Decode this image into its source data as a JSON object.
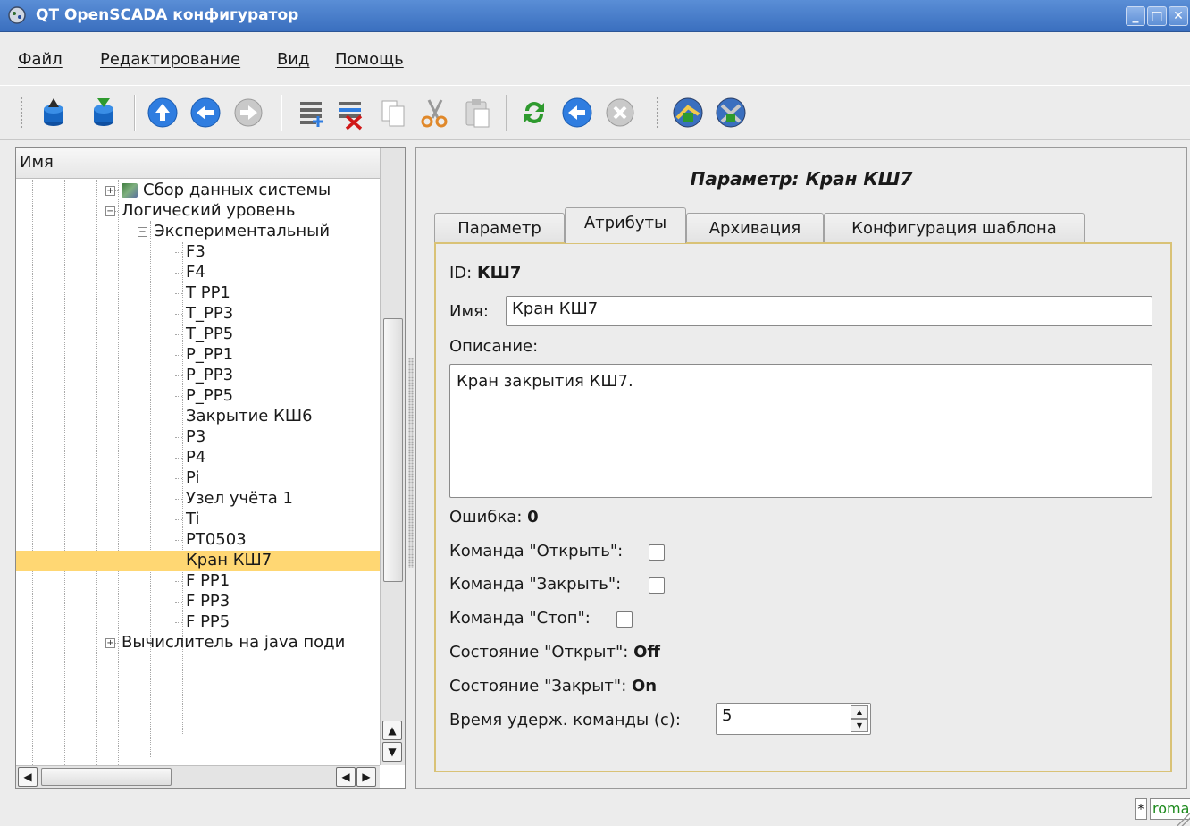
{
  "window": {
    "title": "QT OpenSCADA конфигуратор",
    "minimize": "_",
    "maximize": "□",
    "close": "✕"
  },
  "menu": [
    "Файл",
    "Редактирование",
    "Вид",
    "Помощь"
  ],
  "toolbar": {
    "icons": [
      "db-load-icon",
      "db-save-icon",
      "up-icon",
      "back-icon",
      "forward-icon",
      "add-item-icon",
      "delete-item-icon",
      "copy-icon",
      "cut-icon",
      "paste-icon",
      "refresh-icon",
      "start-icon",
      "stop-icon",
      "station-connect-icon",
      "station-settings-icon"
    ]
  },
  "tree": {
    "header": "Имя",
    "rows": [
      {
        "label": "Сбор данных системы",
        "level": 1,
        "expand": "+",
        "icon": true
      },
      {
        "label": "Логический уровень",
        "level": 1,
        "expand": "−"
      },
      {
        "label": "Экспериментальный",
        "level": 2,
        "expand": "−"
      },
      {
        "label": "F3",
        "level": 3
      },
      {
        "label": "F4",
        "level": 3
      },
      {
        "label": "T PP1",
        "level": 3
      },
      {
        "label": "T_PP3",
        "level": 3
      },
      {
        "label": "T_PP5",
        "level": 3
      },
      {
        "label": "P_PP1",
        "level": 3
      },
      {
        "label": "P_PP3",
        "level": 3
      },
      {
        "label": "P_PP5",
        "level": 3
      },
      {
        "label": "Закрытие КШ6",
        "level": 3
      },
      {
        "label": "P3",
        "level": 3
      },
      {
        "label": "P4",
        "level": 3
      },
      {
        "label": "Pi",
        "level": 3
      },
      {
        "label": "Узел учёта 1",
        "level": 3
      },
      {
        "label": "Ti",
        "level": 3
      },
      {
        "label": "PT0503",
        "level": 3
      },
      {
        "label": "Кран КШ7",
        "level": 3,
        "selected": true
      },
      {
        "label": "F PP1",
        "level": 3
      },
      {
        "label": "F PP3",
        "level": 3
      },
      {
        "label": "F PP5",
        "level": 3
      },
      {
        "label": "Вычислитель на java поди",
        "level": 1,
        "expand": "+"
      }
    ]
  },
  "panel": {
    "title": "Параметр: Кран КШ7",
    "tabs": [
      "Параметр",
      "Атрибуты",
      "Архивация",
      "Конфигурация шаблона"
    ],
    "active_tab": "Атрибуты",
    "id_label": "ID:",
    "id_value": "КШ7",
    "name_label": "Имя:",
    "name_value": "Кран КШ7",
    "descr_label": "Описание:",
    "descr_value": "Кран закрытия КШ7.",
    "error_label": "Ошибка:",
    "error_value": "0",
    "cmd_open_label": "Команда \"Открыть\":",
    "cmd_close_label": "Команда \"Закрыть\":",
    "cmd_stop_label": "Команда \"Стоп\":",
    "st_open_label": "Состояние \"Открыт\":",
    "st_open_value": "Off",
    "st_close_label": "Состояние \"Закрыт\":",
    "st_close_value": "On",
    "hold_label": "Время удерж. команды (с):",
    "hold_value": "5"
  },
  "status": {
    "modified": "*",
    "user": "roman"
  }
}
